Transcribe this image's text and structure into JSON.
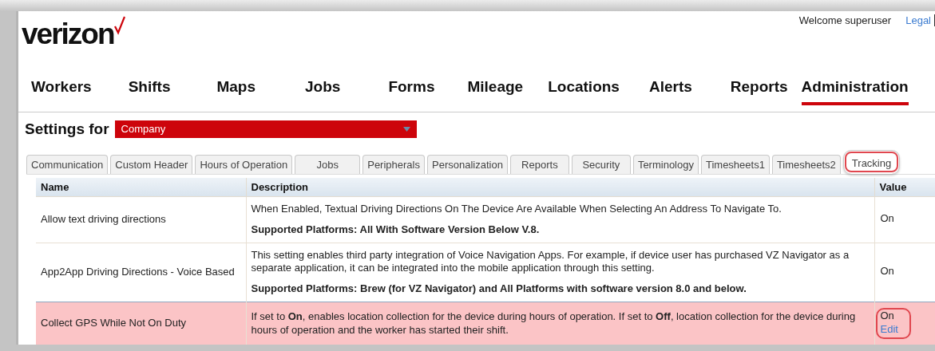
{
  "header": {
    "logo": "verizon",
    "welcome": "Welcome superuser",
    "legal_link": "Legal"
  },
  "nav": [
    {
      "label": "Workers",
      "selected": false
    },
    {
      "label": "Shifts",
      "selected": false
    },
    {
      "label": "Maps",
      "selected": false
    },
    {
      "label": "Jobs",
      "selected": false
    },
    {
      "label": "Forms",
      "selected": false
    },
    {
      "label": "Mileage",
      "selected": false
    },
    {
      "label": "Locations",
      "selected": false
    },
    {
      "label": "Alerts",
      "selected": false
    },
    {
      "label": "Reports",
      "selected": false
    },
    {
      "label": "Administration",
      "selected": true
    }
  ],
  "settings_for": {
    "label": "Settings for",
    "value": "Company"
  },
  "tabs": [
    {
      "label": "Communication",
      "selected": false,
      "highlighted": false
    },
    {
      "label": "Custom Header",
      "selected": false,
      "highlighted": false
    },
    {
      "label": "Hours of Operation",
      "selected": false,
      "highlighted": false
    },
    {
      "label": "Jobs",
      "selected": false,
      "highlighted": false
    },
    {
      "label": "Peripherals",
      "selected": false,
      "highlighted": false
    },
    {
      "label": "Personalization",
      "selected": false,
      "highlighted": false
    },
    {
      "label": "Reports",
      "selected": false,
      "highlighted": false
    },
    {
      "label": "Security",
      "selected": false,
      "highlighted": false
    },
    {
      "label": "Terminology",
      "selected": false,
      "highlighted": false
    },
    {
      "label": "Timesheets1",
      "selected": false,
      "highlighted": false
    },
    {
      "label": "Timesheets2",
      "selected": false,
      "highlighted": false
    },
    {
      "label": "Tracking",
      "selected": true,
      "highlighted": true
    }
  ],
  "table": {
    "columns": [
      "Name",
      "Description",
      "Value"
    ],
    "rows": [
      {
        "name": "Allow text driving directions",
        "description": [
          "When Enabled, Textual Driving Directions On The Device Are Available When Selecting An Address To Navigate To.",
          "**Supported Platforms: All With Software Version Below V.8.**"
        ],
        "value": "On",
        "selected": false,
        "highlighted": false
      },
      {
        "name": "App2App Driving Directions - Voice Based",
        "description": [
          "This setting enables third party integration of Voice Navigation Apps. For example, if device user has purchased VZ Navigator as a separate application, it can be integrated into the mobile application through this setting.",
          "**Supported Platforms: Brew (for VZ Navigator) and All Platforms with software version 8.0 and below.**"
        ],
        "value": "On",
        "selected": false,
        "highlighted": false
      },
      {
        "name": "Collect GPS While Not On Duty",
        "description": [
          "If set to **On**, enables location collection for the device during hours of operation. If set to **Off**, location collection for the device during hours of operation and the worker has started their shift."
        ],
        "value": "On",
        "edit_link": "Edit",
        "selected": true,
        "highlighted": true
      }
    ]
  }
}
